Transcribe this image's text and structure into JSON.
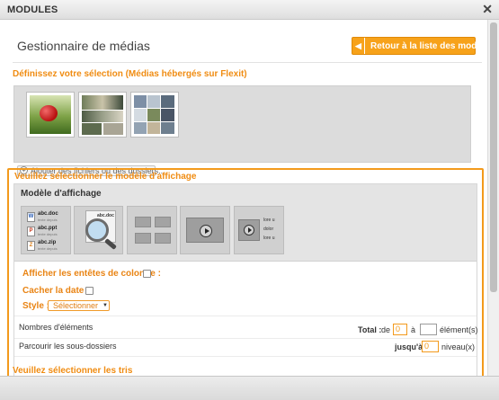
{
  "window": {
    "title": "MODULES",
    "close_icon": "close-icon"
  },
  "header": {
    "title": "Gestionnaire de médias",
    "back_button_label": "Retour à la liste des modules",
    "back_button_icon": "chevron-left-icon"
  },
  "selection": {
    "label": "Définissez votre sélection (Médias hébergés sur Flexit)",
    "thumbnails": [
      "apple-photo-thumbnail",
      "photo-grid-thumbnail",
      "photo-mosaic-thumbnail"
    ],
    "add_button_label": "Ajouter des fichiers ou des dossiers..."
  },
  "display": {
    "section_label": "Veuillez sélectionner le modèle d'affichage",
    "header": "Modèle d'affichage",
    "templates": {
      "file_list": {
        "files": [
          {
            "name": "abc.doc",
            "sub": "texte depuis",
            "icon": "W"
          },
          {
            "name": "abc.ppt",
            "sub": "texte depuis",
            "icon": "P"
          },
          {
            "name": "abc.zip",
            "sub": "texte depuis",
            "icon": "Z"
          }
        ]
      },
      "magnifier": {
        "doc_line": "abc.doc"
      },
      "video_list": {
        "lines": [
          "lore u",
          "dolor",
          "lore u"
        ]
      }
    },
    "options": {
      "show_headers_label": "Afficher les entêtes de colonne :",
      "hide_date_label": "Cacher la date :",
      "style_label": "Style :",
      "style_value": "Sélectionner",
      "count_label": "Nombres d'éléments",
      "total_label": "Total :",
      "from_label": "de",
      "from_value": "0",
      "to_label": "à",
      "to_value": "",
      "elements_unit": "élément(s)",
      "subfolders_label": "Parcourir les sous-dossiers",
      "depth_label": "jusqu'à",
      "depth_value": "0",
      "depth_unit": "niveau(x)"
    }
  },
  "sorting": {
    "section_label": "Veuillez sélectionner les tris"
  },
  "colors": {
    "accent": "#f39a1c",
    "accent_text": "#f08c12",
    "button": "#f7a21a"
  }
}
